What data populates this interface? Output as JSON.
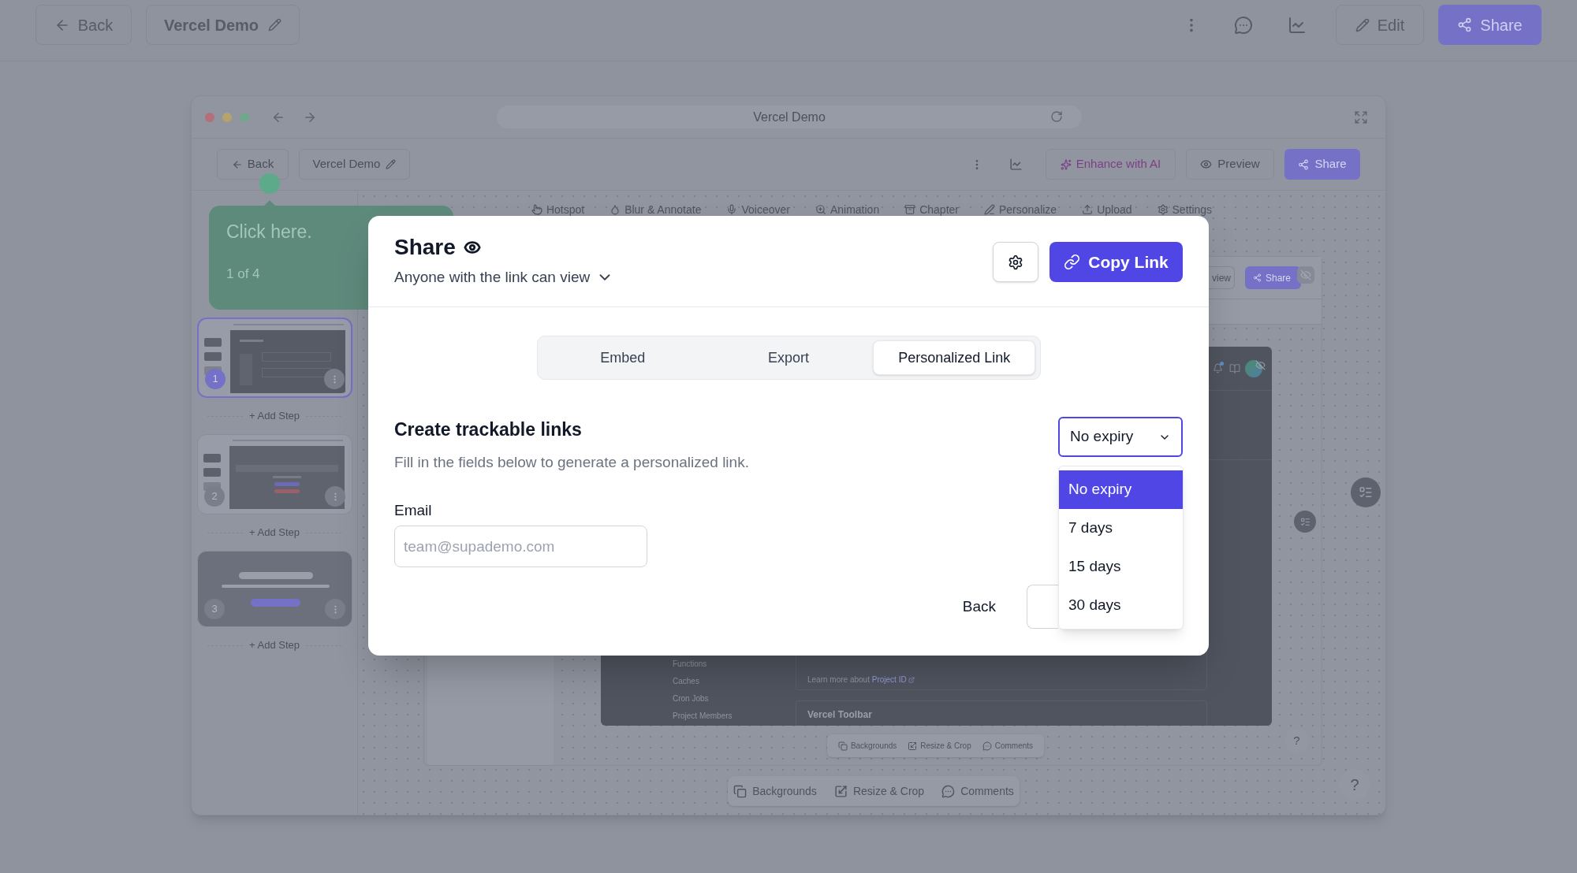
{
  "top_bar": {
    "back": "Back",
    "title": "Vercel Demo",
    "edit": "Edit",
    "share": "Share"
  },
  "editor": {
    "browser_bar": {
      "title": "Vercel Demo"
    },
    "toolbar": {
      "back": "Back",
      "title": "Vercel Demo",
      "enhance": "Enhance with AI",
      "preview": "Preview",
      "share": "Share"
    },
    "tools": [
      "Hotspot",
      "Blur & Annotate",
      "Voiceover",
      "Animation",
      "Chapter",
      "Personalize",
      "Upload",
      "Settings"
    ],
    "tooltip": {
      "text": "Click here.",
      "counter": "1 of 4"
    },
    "steps": [
      {
        "number": "1",
        "kind": "page",
        "selected": true,
        "add_label": "+ Add Step"
      },
      {
        "number": "2",
        "kind": "popup",
        "selected": false,
        "add_label": "+ Add Step"
      },
      {
        "number": "3",
        "kind": "card",
        "selected": false,
        "add_label": "+ Add Step"
      }
    ],
    "preview": {
      "header": {
        "preview_button": "view",
        "share": "Share"
      },
      "nav": [
        "Functions",
        "Caches",
        "Cron Jobs",
        "Project Members"
      ],
      "note": "Learn more about",
      "link": "Project ID",
      "section_title": "Vercel Toolbar"
    },
    "screen_toolbar": [
      "Backgrounds",
      "Resize & Crop",
      "Comments"
    ],
    "canvas_toolbar": [
      "Backgrounds",
      "Resize & Crop",
      "Comments"
    ],
    "help_buttons": [
      "?",
      "?"
    ]
  },
  "share_dialog": {
    "title": "Share",
    "visibility": "Anyone with the link can view",
    "copy_link": "Copy Link",
    "tabs": [
      {
        "label": "Embed",
        "selected": false
      },
      {
        "label": "Export",
        "selected": false
      },
      {
        "label": "Personalized Link",
        "selected": true
      }
    ],
    "heading": "Create trackable links",
    "description": "Fill in the fields below to generate a personalized link.",
    "email": {
      "label": "Email",
      "placeholder": "team@supademo.com"
    },
    "expiry": {
      "value": "No expiry",
      "expanded": true,
      "options": [
        {
          "label": "No expiry",
          "selected": true
        },
        {
          "label": "7 days",
          "selected": false
        },
        {
          "label": "15 days",
          "selected": false
        },
        {
          "label": "30 days",
          "selected": false
        }
      ]
    },
    "back": "Back"
  }
}
